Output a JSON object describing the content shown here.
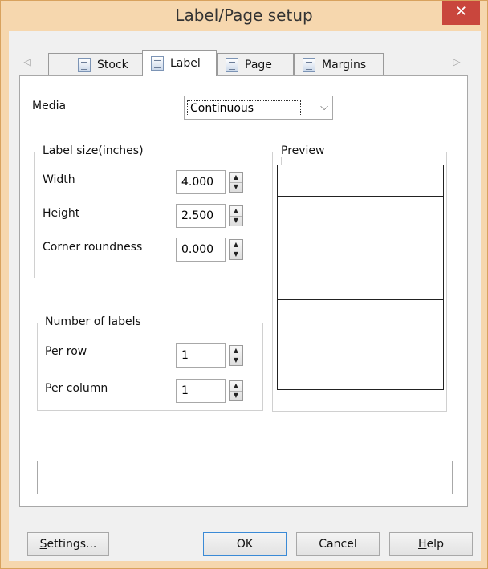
{
  "window": {
    "title": "Label/Page setup",
    "close_glyph": "✕",
    "titlebar_color": "#f6d7ae",
    "close_color": "#c9463d"
  },
  "tabs": {
    "left_arrow": "◁",
    "right_arrow": "▷",
    "items": [
      {
        "label": "Stock",
        "icon": "stock-icon",
        "active": false
      },
      {
        "label": "Label",
        "icon": "label-icon",
        "active": true
      },
      {
        "label": "Page",
        "icon": "page-icon",
        "active": false
      },
      {
        "label": "Margins",
        "icon": "margins-icon",
        "active": false
      }
    ]
  },
  "media": {
    "label": "Media",
    "value": "Continuous",
    "arrow": "⌵"
  },
  "label_size": {
    "title": "Label size(inches)",
    "width_label": "Width",
    "width_value": "4.000",
    "height_label": "Height",
    "height_value": "2.500",
    "corner_label": "Corner roundness",
    "corner_value": "0.000"
  },
  "number_of_labels": {
    "title": "Number of labels",
    "per_row_label": "Per row",
    "per_row_value": "1",
    "per_column_label": "Per column",
    "per_column_value": "1"
  },
  "preview": {
    "title": "Preview"
  },
  "spin": {
    "up": "▲",
    "down": "▼"
  },
  "buttons": {
    "settings_u": "S",
    "settings_rest": "ettings...",
    "ok": "OK",
    "cancel": "Cancel",
    "help_u": "H",
    "help_rest": "elp"
  }
}
